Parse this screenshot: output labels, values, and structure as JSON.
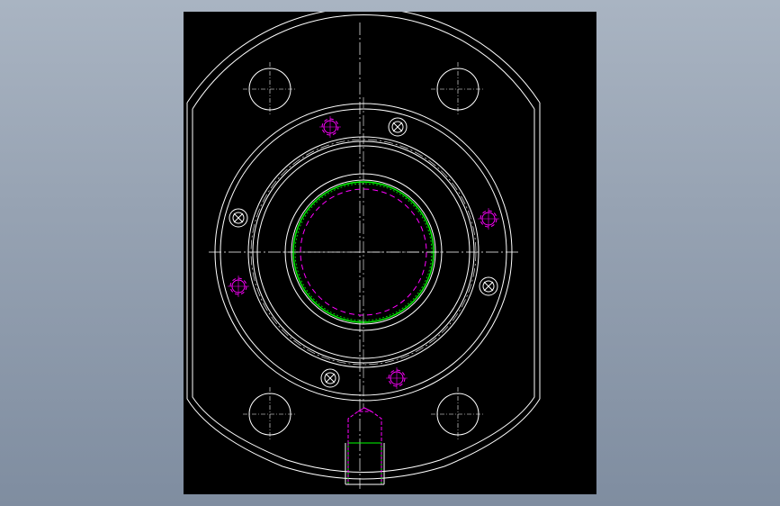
{
  "drawing": {
    "background_color": "#000000",
    "outline_color": "#ffffff",
    "bore_color": "#00ff00",
    "hidden_color": "#ff00ff"
  },
  "icons": {
    "screw_head": "cross-recess-screw-icon",
    "threaded_hole": "tapped-hole-icon",
    "mounting_hole": "bolt-hole-icon"
  }
}
